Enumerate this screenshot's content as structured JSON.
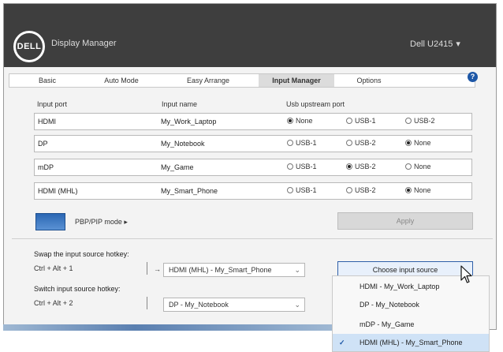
{
  "app": {
    "logo_text": "DELL",
    "title": "Display Manager",
    "monitor_label": "Dell U2415",
    "monitor_chevron": "▾"
  },
  "tabs": [
    {
      "label": "Basic"
    },
    {
      "label": "Auto Mode"
    },
    {
      "label": "Easy Arrange"
    },
    {
      "label": "Input Manager"
    },
    {
      "label": "Options"
    }
  ],
  "help_label": "?",
  "columns": {
    "input_port": "Input port",
    "input_name": "Input name",
    "usb_assignment": "Usb upstream port"
  },
  "ports": [
    {
      "port": "HDMI",
      "name": "My_Work_Laptop",
      "opts": [
        "None",
        "USB-1",
        "USB-2"
      ],
      "selected": 0
    },
    {
      "port": "DP",
      "name": "My_Notebook",
      "opts": [
        "USB-1",
        "USB-2",
        "None"
      ],
      "selected": 2
    },
    {
      "port": "mDP",
      "name": "My_Game",
      "opts": [
        "USB-1",
        "USB-2",
        "None"
      ],
      "selected": 1
    },
    {
      "port": "HDMI (MHL)",
      "name": "My_Smart_Phone",
      "opts": [
        "USB-1",
        "USB-2",
        "None"
      ],
      "selected": 2
    }
  ],
  "pbp": {
    "label": "PBP/PIP mode ▸",
    "apply_label": "Apply"
  },
  "swap_section": {
    "label": "Swap the input source hotkey:",
    "shortcut": "Ctrl + Alt + 1",
    "arrow": "→",
    "select_value": "HDMI (MHL) - My_Smart_Phone",
    "select_arrow": "⌄"
  },
  "switch_section": {
    "label": "Switch input source hotkey:",
    "shortcut": "Ctrl + Alt + 2",
    "select_value": "DP - My_Notebook",
    "select_arrow": "⌄",
    "dropdown_label": "Choose input source"
  },
  "menu": [
    {
      "label": "HDMI - My_Work_Laptop",
      "checked": false
    },
    {
      "label": "DP - My_Notebook",
      "checked": false
    },
    {
      "label": "mDP - My_Game",
      "checked": false
    },
    {
      "label": "HDMI (MHL) - My_Smart_Phone",
      "checked": true
    }
  ],
  "menu_check": "✓"
}
